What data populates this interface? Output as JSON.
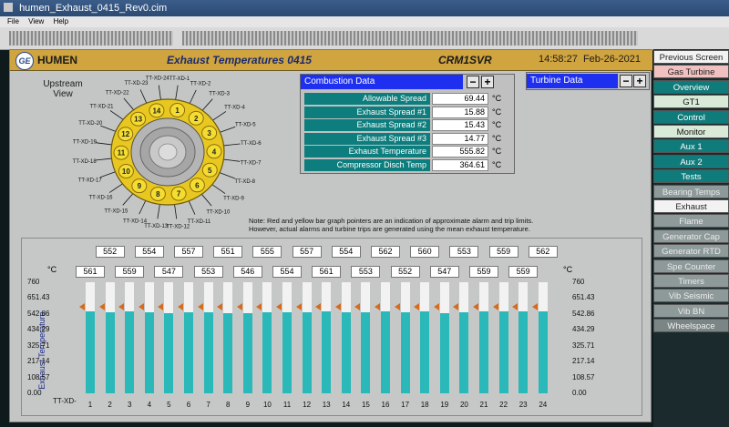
{
  "window": {
    "title": "humen_Exhaust_0415_Rev0.cim",
    "menu": [
      "File",
      "View",
      "Help"
    ]
  },
  "header": {
    "logo": "GE",
    "site": "HUMEN",
    "title": "Exhaust Temperatures 0415",
    "unit": "CRM1SVR",
    "time": "14:58:27",
    "date": "Feb-26-2021"
  },
  "wheel": {
    "upstream_label": "Upstream View",
    "combustors": [
      "1",
      "2",
      "3",
      "4",
      "5",
      "6",
      "7",
      "8",
      "9",
      "10",
      "11",
      "12",
      "13",
      "14"
    ],
    "thermocouples": [
      "TT-XD-1",
      "TT-XD-2",
      "TT-XD-3",
      "TT-XD-4",
      "TT-XD-5",
      "TT-XD-6",
      "TT-XD-7",
      "TT-XD-8",
      "TT-XD-9",
      "TT-XD-10",
      "TT-XD-11",
      "TT-XD-12",
      "TT-XD-13",
      "TT-XD-14",
      "TT-XD-15",
      "TT-XD-16",
      "TT-XD-17",
      "TT-XD-18",
      "TT-XD-19",
      "TT-XD-20",
      "TT-XD-21",
      "TT-XD-22",
      "TT-XD-23",
      "TT-XD-24"
    ]
  },
  "combustion": {
    "title": "Combustion Data",
    "minus": "−",
    "plus": "+",
    "rows": [
      {
        "label": "Allowable Spread",
        "value": "69.44",
        "unit": "°C"
      },
      {
        "label": "Exhaust Spread #1",
        "value": "15.88",
        "unit": "°C"
      },
      {
        "label": "Exhaust Spread #2",
        "value": "15.43",
        "unit": "°C"
      },
      {
        "label": "Exhaust Spread #3",
        "value": "14.77",
        "unit": "°C"
      },
      {
        "label": "Exhaust Temperature",
        "value": "555.82",
        "unit": "°C"
      },
      {
        "label": "Compressor Disch Temp",
        "value": "364.61",
        "unit": "°C"
      }
    ]
  },
  "turbine": {
    "title": "Turbine Data",
    "minus": "−",
    "plus": "+"
  },
  "note": {
    "line1": "Note: Red and yellow bar graph pointers are an indication of approximate alarm and trip limits.",
    "line2": "However, actual alarms and turbine trips are generated using the mean exhaust temperature."
  },
  "chart_data": {
    "type": "bar",
    "categories": [
      "1",
      "2",
      "3",
      "4",
      "5",
      "6",
      "7",
      "8",
      "9",
      "10",
      "11",
      "12",
      "13",
      "14",
      "15",
      "16",
      "17",
      "18",
      "19",
      "20",
      "21",
      "22",
      "23",
      "24"
    ],
    "values": [
      561,
      552,
      559,
      554,
      547,
      557,
      553,
      551,
      546,
      555,
      554,
      557,
      561,
      554,
      553,
      562,
      552,
      560,
      547,
      553,
      559,
      559,
      559,
      562
    ],
    "ylim": [
      0,
      760
    ],
    "yticks": [
      "760",
      "651.43",
      "542.86",
      "434.29",
      "325.71",
      "217.14",
      "108.57",
      "0.00"
    ],
    "ylabel": "Exhaust Temperature",
    "xlabel": "TT-XD-",
    "unit": "°C",
    "alarm_pointer": 590,
    "colors": {
      "bar": "#2ab8b8",
      "pointer": "#d86a1c"
    }
  },
  "chart_labels": {
    "unit_left": "°C",
    "unit_right": "°C",
    "xprefix": "TT-XD-"
  },
  "sidebar": [
    {
      "label": "Previous Screen",
      "style": "s-white"
    },
    {
      "label": "Gas Turbine",
      "style": "s-pink"
    },
    {
      "label": "Overview",
      "style": "s-teal"
    },
    {
      "label": "GT1",
      "style": "s-lite"
    },
    {
      "label": "Control",
      "style": "s-teal"
    },
    {
      "label": "Monitor",
      "style": "s-lite"
    },
    {
      "label": "Aux 1",
      "style": "s-teal"
    },
    {
      "label": "Aux 2",
      "style": "s-teal"
    },
    {
      "label": "Tests",
      "style": "s-teal"
    },
    {
      "label": "Bearing Temps",
      "style": "s-gray"
    },
    {
      "label": "Exhaust",
      "style": "s-white"
    },
    {
      "label": "Flame",
      "style": "s-gray"
    },
    {
      "label": "Generator Cap",
      "style": "s-gray"
    },
    {
      "label": "Generator RTD",
      "style": "s-gray"
    },
    {
      "label": "Spe Counter",
      "style": "s-gray"
    },
    {
      "label": "Timers",
      "style": "s-gray"
    },
    {
      "label": "Vib Seismic",
      "style": "s-gray"
    },
    {
      "label": "Vib BN",
      "style": "s-gray"
    },
    {
      "label": "Wheelspace",
      "style": "s-dark"
    }
  ]
}
